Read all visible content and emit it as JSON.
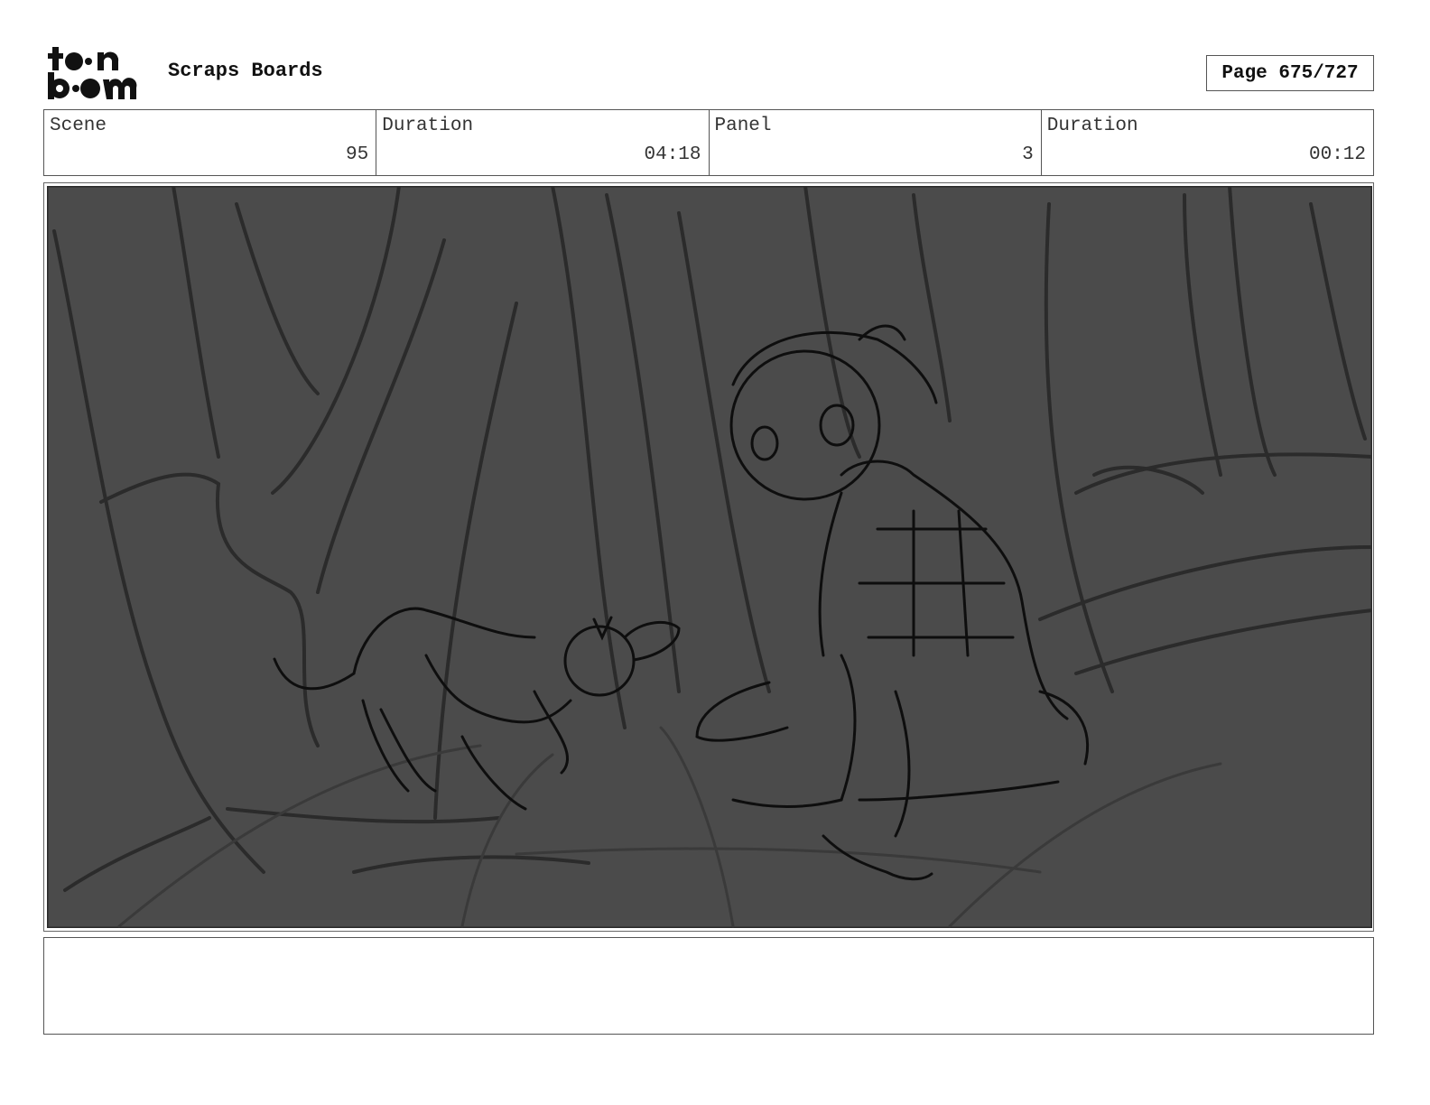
{
  "header": {
    "logo_text": "toon boom",
    "title": "Scraps Boards",
    "page_label": "Page 675/727"
  },
  "info": [
    {
      "label": "Scene",
      "value": "95"
    },
    {
      "label": "Duration",
      "value": "04:18"
    },
    {
      "label": "Panel",
      "value": "3"
    },
    {
      "label": "Duration",
      "value": "00:12"
    }
  ],
  "notes": {
    "text": ""
  },
  "colors": {
    "panel_bg": "#4a4a4a",
    "ink": "#111111",
    "frame": "#555555"
  }
}
